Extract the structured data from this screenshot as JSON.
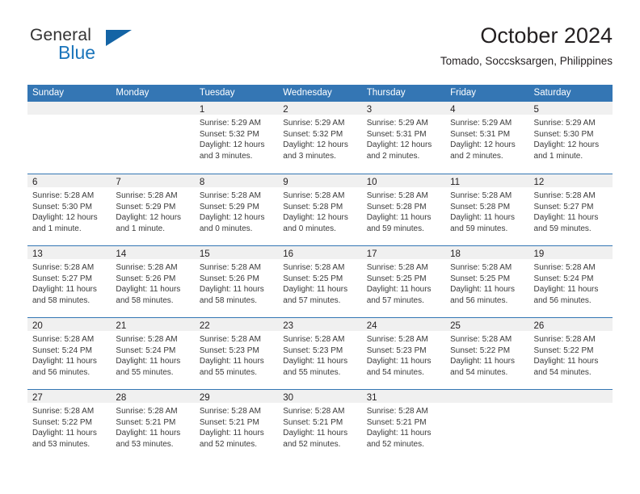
{
  "brand": {
    "name_top": "General",
    "name_bottom": "Blue",
    "accent_color": "#1b75bb"
  },
  "header": {
    "title": "October 2024",
    "subtitle": "Tomado, Soccsksargen, Philippines"
  },
  "theme": {
    "header_bar_color": "#3476b4",
    "day_band_color": "#f0f0f0",
    "text_color": "#231f20"
  },
  "labels": {
    "sunrise_prefix": "Sunrise:",
    "sunset_prefix": "Sunset:",
    "daylight_prefix": "Daylight:"
  },
  "weekdays": [
    "Sunday",
    "Monday",
    "Tuesday",
    "Wednesday",
    "Thursday",
    "Friday",
    "Saturday"
  ],
  "weeks": [
    [
      {
        "day": "",
        "empty": true
      },
      {
        "day": "",
        "empty": true
      },
      {
        "day": "1",
        "sunrise": "Sunrise: 5:29 AM",
        "sunset": "Sunset: 5:32 PM",
        "daylight1": "Daylight: 12 hours",
        "daylight2": "and 3 minutes."
      },
      {
        "day": "2",
        "sunrise": "Sunrise: 5:29 AM",
        "sunset": "Sunset: 5:32 PM",
        "daylight1": "Daylight: 12 hours",
        "daylight2": "and 3 minutes."
      },
      {
        "day": "3",
        "sunrise": "Sunrise: 5:29 AM",
        "sunset": "Sunset: 5:31 PM",
        "daylight1": "Daylight: 12 hours",
        "daylight2": "and 2 minutes."
      },
      {
        "day": "4",
        "sunrise": "Sunrise: 5:29 AM",
        "sunset": "Sunset: 5:31 PM",
        "daylight1": "Daylight: 12 hours",
        "daylight2": "and 2 minutes."
      },
      {
        "day": "5",
        "sunrise": "Sunrise: 5:29 AM",
        "sunset": "Sunset: 5:30 PM",
        "daylight1": "Daylight: 12 hours",
        "daylight2": "and 1 minute."
      }
    ],
    [
      {
        "day": "6",
        "sunrise": "Sunrise: 5:28 AM",
        "sunset": "Sunset: 5:30 PM",
        "daylight1": "Daylight: 12 hours",
        "daylight2": "and 1 minute."
      },
      {
        "day": "7",
        "sunrise": "Sunrise: 5:28 AM",
        "sunset": "Sunset: 5:29 PM",
        "daylight1": "Daylight: 12 hours",
        "daylight2": "and 1 minute."
      },
      {
        "day": "8",
        "sunrise": "Sunrise: 5:28 AM",
        "sunset": "Sunset: 5:29 PM",
        "daylight1": "Daylight: 12 hours",
        "daylight2": "and 0 minutes."
      },
      {
        "day": "9",
        "sunrise": "Sunrise: 5:28 AM",
        "sunset": "Sunset: 5:28 PM",
        "daylight1": "Daylight: 12 hours",
        "daylight2": "and 0 minutes."
      },
      {
        "day": "10",
        "sunrise": "Sunrise: 5:28 AM",
        "sunset": "Sunset: 5:28 PM",
        "daylight1": "Daylight: 11 hours",
        "daylight2": "and 59 minutes."
      },
      {
        "day": "11",
        "sunrise": "Sunrise: 5:28 AM",
        "sunset": "Sunset: 5:28 PM",
        "daylight1": "Daylight: 11 hours",
        "daylight2": "and 59 minutes."
      },
      {
        "day": "12",
        "sunrise": "Sunrise: 5:28 AM",
        "sunset": "Sunset: 5:27 PM",
        "daylight1": "Daylight: 11 hours",
        "daylight2": "and 59 minutes."
      }
    ],
    [
      {
        "day": "13",
        "sunrise": "Sunrise: 5:28 AM",
        "sunset": "Sunset: 5:27 PM",
        "daylight1": "Daylight: 11 hours",
        "daylight2": "and 58 minutes."
      },
      {
        "day": "14",
        "sunrise": "Sunrise: 5:28 AM",
        "sunset": "Sunset: 5:26 PM",
        "daylight1": "Daylight: 11 hours",
        "daylight2": "and 58 minutes."
      },
      {
        "day": "15",
        "sunrise": "Sunrise: 5:28 AM",
        "sunset": "Sunset: 5:26 PM",
        "daylight1": "Daylight: 11 hours",
        "daylight2": "and 58 minutes."
      },
      {
        "day": "16",
        "sunrise": "Sunrise: 5:28 AM",
        "sunset": "Sunset: 5:25 PM",
        "daylight1": "Daylight: 11 hours",
        "daylight2": "and 57 minutes."
      },
      {
        "day": "17",
        "sunrise": "Sunrise: 5:28 AM",
        "sunset": "Sunset: 5:25 PM",
        "daylight1": "Daylight: 11 hours",
        "daylight2": "and 57 minutes."
      },
      {
        "day": "18",
        "sunrise": "Sunrise: 5:28 AM",
        "sunset": "Sunset: 5:25 PM",
        "daylight1": "Daylight: 11 hours",
        "daylight2": "and 56 minutes."
      },
      {
        "day": "19",
        "sunrise": "Sunrise: 5:28 AM",
        "sunset": "Sunset: 5:24 PM",
        "daylight1": "Daylight: 11 hours",
        "daylight2": "and 56 minutes."
      }
    ],
    [
      {
        "day": "20",
        "sunrise": "Sunrise: 5:28 AM",
        "sunset": "Sunset: 5:24 PM",
        "daylight1": "Daylight: 11 hours",
        "daylight2": "and 56 minutes."
      },
      {
        "day": "21",
        "sunrise": "Sunrise: 5:28 AM",
        "sunset": "Sunset: 5:24 PM",
        "daylight1": "Daylight: 11 hours",
        "daylight2": "and 55 minutes."
      },
      {
        "day": "22",
        "sunrise": "Sunrise: 5:28 AM",
        "sunset": "Sunset: 5:23 PM",
        "daylight1": "Daylight: 11 hours",
        "daylight2": "and 55 minutes."
      },
      {
        "day": "23",
        "sunrise": "Sunrise: 5:28 AM",
        "sunset": "Sunset: 5:23 PM",
        "daylight1": "Daylight: 11 hours",
        "daylight2": "and 55 minutes."
      },
      {
        "day": "24",
        "sunrise": "Sunrise: 5:28 AM",
        "sunset": "Sunset: 5:23 PM",
        "daylight1": "Daylight: 11 hours",
        "daylight2": "and 54 minutes."
      },
      {
        "day": "25",
        "sunrise": "Sunrise: 5:28 AM",
        "sunset": "Sunset: 5:22 PM",
        "daylight1": "Daylight: 11 hours",
        "daylight2": "and 54 minutes."
      },
      {
        "day": "26",
        "sunrise": "Sunrise: 5:28 AM",
        "sunset": "Sunset: 5:22 PM",
        "daylight1": "Daylight: 11 hours",
        "daylight2": "and 54 minutes."
      }
    ],
    [
      {
        "day": "27",
        "sunrise": "Sunrise: 5:28 AM",
        "sunset": "Sunset: 5:22 PM",
        "daylight1": "Daylight: 11 hours",
        "daylight2": "and 53 minutes."
      },
      {
        "day": "28",
        "sunrise": "Sunrise: 5:28 AM",
        "sunset": "Sunset: 5:21 PM",
        "daylight1": "Daylight: 11 hours",
        "daylight2": "and 53 minutes."
      },
      {
        "day": "29",
        "sunrise": "Sunrise: 5:28 AM",
        "sunset": "Sunset: 5:21 PM",
        "daylight1": "Daylight: 11 hours",
        "daylight2": "and 52 minutes."
      },
      {
        "day": "30",
        "sunrise": "Sunrise: 5:28 AM",
        "sunset": "Sunset: 5:21 PM",
        "daylight1": "Daylight: 11 hours",
        "daylight2": "and 52 minutes."
      },
      {
        "day": "31",
        "sunrise": "Sunrise: 5:28 AM",
        "sunset": "Sunset: 5:21 PM",
        "daylight1": "Daylight: 11 hours",
        "daylight2": "and 52 minutes."
      },
      {
        "day": "",
        "empty": true
      },
      {
        "day": "",
        "empty": true
      }
    ]
  ]
}
